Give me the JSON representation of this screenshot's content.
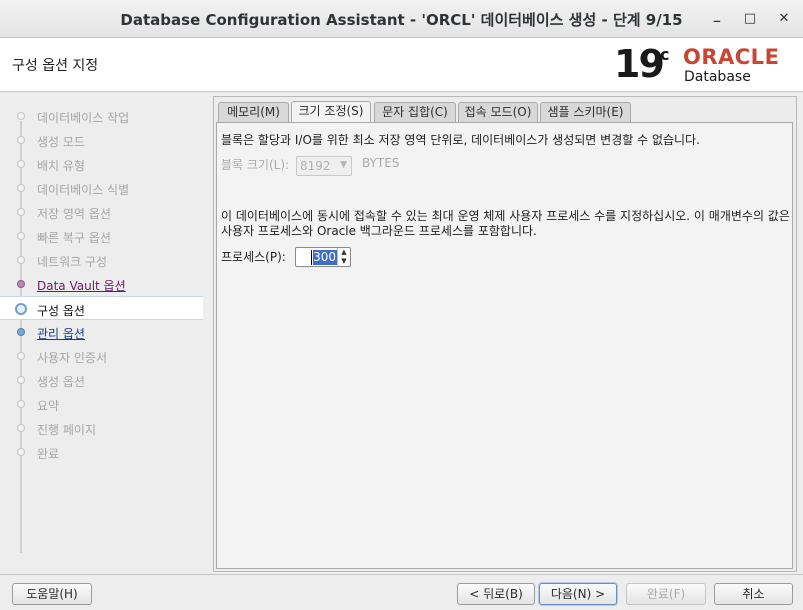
{
  "window": {
    "title": "Database Configuration Assistant - 'ORCL' 데이터베이스 생성 - 단계 9/15",
    "minimize_glyph": "_",
    "maximize_glyph": "□",
    "close_glyph": "✕"
  },
  "header": {
    "step_title": "구성 옵션 지정",
    "logo_version": "19",
    "logo_version_suffix": "c",
    "logo_brand": "ORACLE",
    "logo_product": "Database"
  },
  "sidebar": {
    "steps": [
      {
        "label": "데이터베이스 작업",
        "state": "disabled"
      },
      {
        "label": "생성 모드",
        "state": "disabled"
      },
      {
        "label": "배치 유형",
        "state": "disabled"
      },
      {
        "label": "데이터베이스 식별",
        "state": "disabled"
      },
      {
        "label": "저장 영역 옵션",
        "state": "disabled"
      },
      {
        "label": "빠른 복구 옵션",
        "state": "disabled"
      },
      {
        "label": "네트워크 구성",
        "state": "disabled"
      },
      {
        "label": "Data Vault 옵션",
        "state": "visited"
      },
      {
        "label": "구성 옵션",
        "state": "current"
      },
      {
        "label": "관리 옵션",
        "state": "next"
      },
      {
        "label": "사용자 인증서",
        "state": "disabled"
      },
      {
        "label": "생성 옵션",
        "state": "disabled"
      },
      {
        "label": "요약",
        "state": "disabled"
      },
      {
        "label": "진행 페이지",
        "state": "disabled"
      },
      {
        "label": "완료",
        "state": "disabled"
      }
    ]
  },
  "tabs": [
    {
      "label": "메모리(M)",
      "active": false
    },
    {
      "label": "크기 조정(S)",
      "active": true
    },
    {
      "label": "문자 집합(C)",
      "active": false
    },
    {
      "label": "접속 모드(O)",
      "active": false
    },
    {
      "label": "샘플 스키마(E)",
      "active": false
    }
  ],
  "sizing": {
    "block_desc": "블록은 할당과 I/O를 위한 최소 저장 영역 단위로, 데이터베이스가 생성되면 변경할 수 없습니다.",
    "block_size_label": "블록 크기(L):",
    "block_size_value": "8192",
    "block_size_unit": "BYTES",
    "process_desc_line1": "이 데이터베이스에 동시에 접속할 수 있는 최대 운영 체제 사용자 프로세스 수를 지정하십시오. 이 매개변수의 값은",
    "process_desc_line2": "사용자 프로세스와 Oracle 백그라운드 프로세스를 포함합니다.",
    "processes_label": "프로세스(P):",
    "processes_value": "300"
  },
  "footer": {
    "help": "도움말(H)",
    "back": "< 뒤로(B)",
    "next": "다음(N) >",
    "finish": "완료(F)",
    "cancel": "취소"
  }
}
